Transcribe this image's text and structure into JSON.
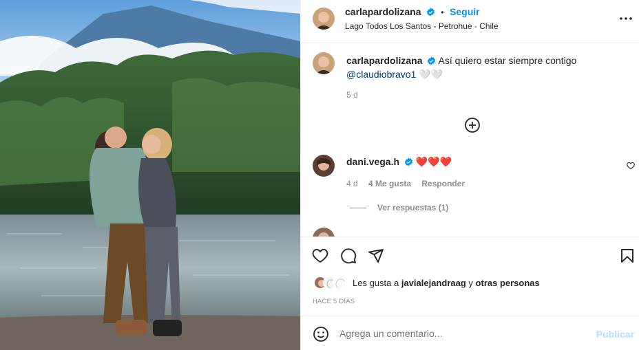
{
  "post": {
    "author": "carlapardolizana",
    "follow_label": "Seguir",
    "dot": "•",
    "location": "Lago Todos Los Santos - Petrohue - Chile",
    "more_icon": "more-horizontal-icon"
  },
  "caption": {
    "author": "carlapardolizana",
    "text": "Así quiero estar siempre contigo",
    "mention": "@claudiobravo1",
    "emoji": "🤍🤍",
    "time": "5 d"
  },
  "load_more_icon": "add-circle-icon",
  "comments": [
    {
      "author": "dani.vega.h",
      "text": "❤️❤️❤️",
      "time": "4 d",
      "likes": "4 Me gusta",
      "reply_label": "Responder",
      "view_replies": "Ver respuestas (1)"
    }
  ],
  "actions": {
    "liked_by_prefix": "Les gusta a",
    "liked_by_user": "javialejandraag",
    "liked_by_conj": "y",
    "liked_by_others": "otras personas",
    "timestamp": "HACE 5 DÍAS"
  },
  "add_comment": {
    "placeholder": "Agrega un comentario...",
    "publish_label": "Publicar"
  },
  "colors": {
    "link": "#0095f6",
    "mention": "#00376b",
    "verified": "#0095f6",
    "publish_disabled": "#b2dffc",
    "heart": "#ed4956"
  }
}
